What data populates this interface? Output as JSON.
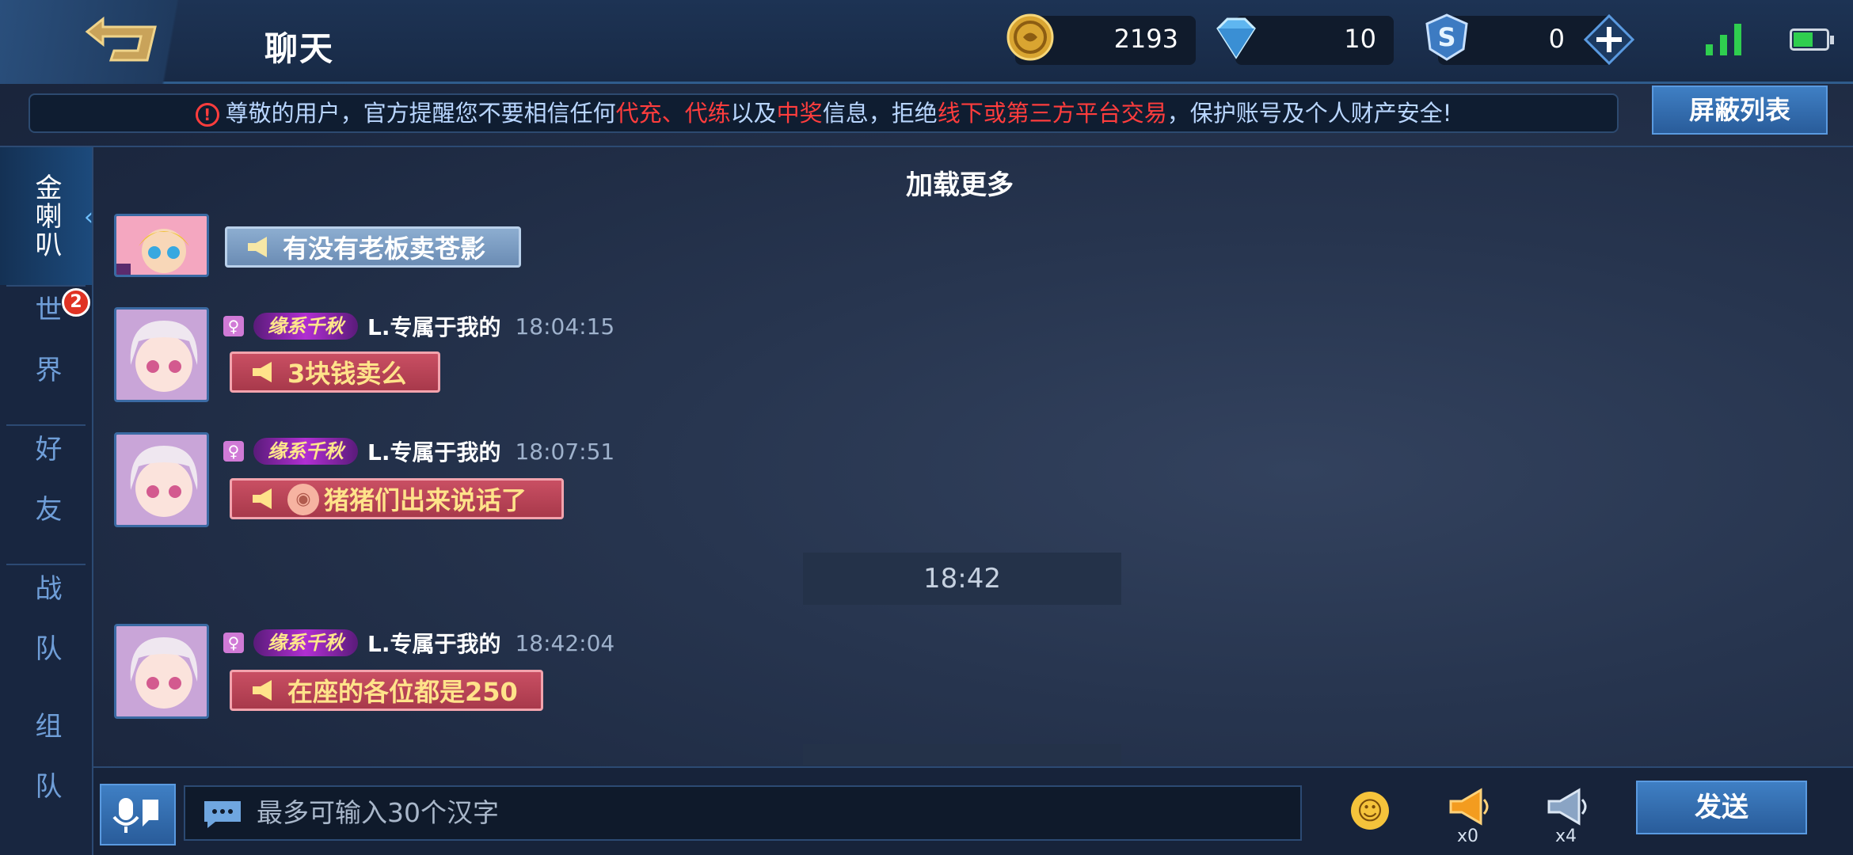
{
  "header": {
    "title": "聊天",
    "gold": "2193",
    "diamonds": "10",
    "points": "0"
  },
  "notice": {
    "p1": "尊敬的用户，官方提醒您不要相信任何",
    "r1": "代充、代练",
    "p2": "以及",
    "r2": "中奖",
    "p3": "信息，拒绝",
    "r3": "线下或第三方平台交易",
    "p4": "，保护账号及个人财产安全!"
  },
  "block_list_label": "屏蔽列表",
  "sidebar": {
    "tabs": [
      {
        "label": "金喇叭"
      },
      {
        "label": "世界",
        "badge": "2"
      },
      {
        "label": "好友"
      },
      {
        "label": "战队"
      },
      {
        "label": "组队"
      }
    ]
  },
  "chat": {
    "load_more": "加载更多",
    "first_message": "有没有老板卖苍影",
    "messages": [
      {
        "title": "缘系千秋",
        "user": "L.专属于我的",
        "time": "18:04:15",
        "text": "3块钱卖么"
      },
      {
        "title": "缘系千秋",
        "user": "L.专属于我的",
        "time": "18:07:51",
        "text": "猪猪们出来说话了"
      },
      {
        "title": "缘系千秋",
        "user": "L.专属于我的",
        "time": "18:42:04",
        "text": "在座的各位都是250"
      }
    ],
    "divider_time": "18:42"
  },
  "input": {
    "placeholder": "最多可输入30个汉字"
  },
  "horns": {
    "gold_count": "x0",
    "normal_count": "x4"
  },
  "send_label": "发送",
  "colors": {
    "accent": "#3f7fc4",
    "warning": "#ff3d3d",
    "bubble": "#c94f63"
  }
}
